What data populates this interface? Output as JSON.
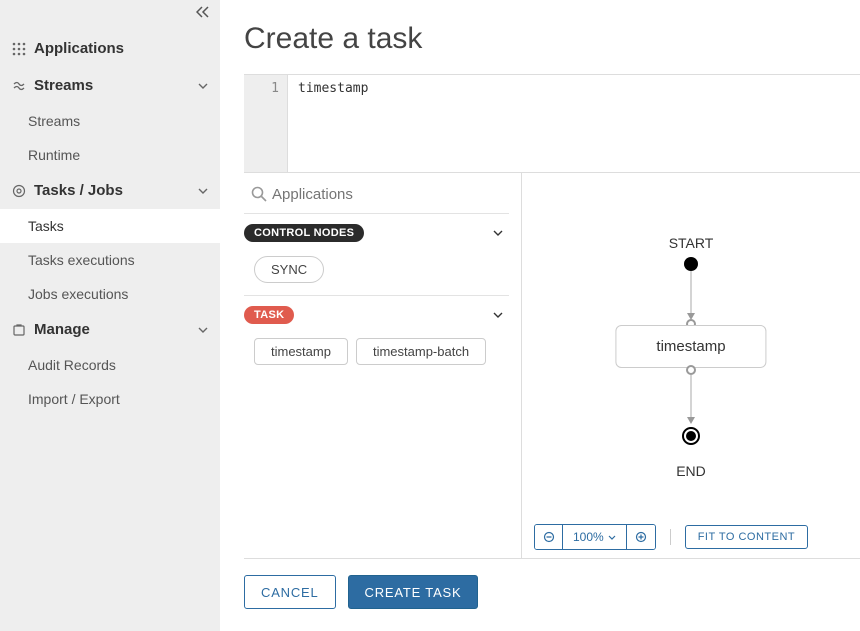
{
  "sidebar": {
    "top_level": {
      "applications": "Applications",
      "streams": "Streams",
      "tasks_jobs": "Tasks / Jobs",
      "manage": "Manage"
    },
    "streams_items": [
      "Streams",
      "Runtime"
    ],
    "tasks_items": [
      "Tasks",
      "Tasks executions",
      "Jobs executions"
    ],
    "manage_items": [
      "Audit Records",
      "Import / Export"
    ]
  },
  "page": {
    "title": "Create a task"
  },
  "editor": {
    "line_number": "1",
    "code": "timestamp"
  },
  "palette": {
    "search_placeholder": "Applications",
    "sections": {
      "control": {
        "label": "CONTROL NODES",
        "items": [
          "SYNC"
        ]
      },
      "task": {
        "label": "TASK",
        "items": [
          "timestamp",
          "timestamp-batch"
        ]
      }
    }
  },
  "canvas": {
    "start_label": "START",
    "task_label": "timestamp",
    "end_label": "END"
  },
  "zoom": {
    "level": "100%",
    "fit_label": "FIT TO CONTENT"
  },
  "footer": {
    "cancel": "CANCEL",
    "create": "CREATE TASK"
  }
}
